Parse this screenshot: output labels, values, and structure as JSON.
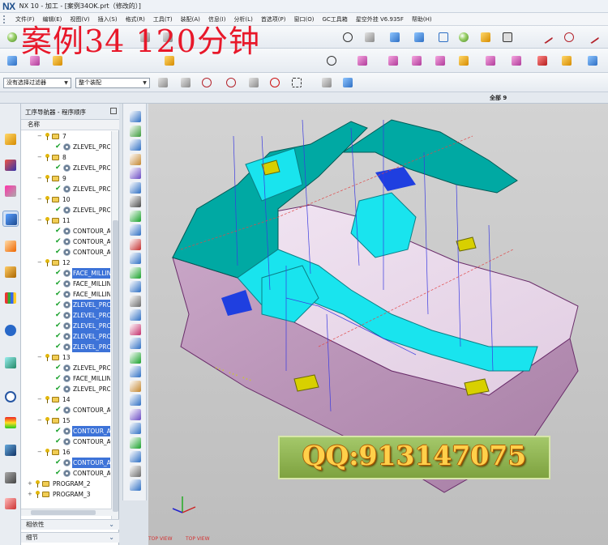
{
  "window": {
    "logo": "NX",
    "title": "NX 10 - 加工 - [案例34OK.prt（修改的）]"
  },
  "menu": [
    "文件(F)",
    "编辑(E)",
    "视图(V)",
    "插入(S)",
    "格式(R)",
    "工具(T)",
    "装配(A)",
    "信息(I)",
    "分析(L)",
    "首选项(P)",
    "窗口(O)",
    "GC工具箱",
    "星空外挂 V6.935F",
    "帮助(H)"
  ],
  "watermark": {
    "title": "案例34  120分钟",
    "qq": "QQ:913147075"
  },
  "toolbar": {
    "filter_select": "没有选择过滤器",
    "assembly_select": "整个装配"
  },
  "status": {
    "all_count": "全部 9"
  },
  "navigator": {
    "title": "工序导航器 - 程序顺序",
    "column_name": "名称",
    "rows": [
      {
        "type": "group",
        "label": "7"
      },
      {
        "type": "op",
        "label": "ZLEVEL_PROFILE",
        "selected": false
      },
      {
        "type": "group",
        "label": "8"
      },
      {
        "type": "op",
        "label": "ZLEVEL_PROFILE",
        "selected": false
      },
      {
        "type": "group",
        "label": "9"
      },
      {
        "type": "op",
        "label": "ZLEVEL_PROFILE",
        "selected": false
      },
      {
        "type": "group",
        "label": "10"
      },
      {
        "type": "op",
        "label": "ZLEVEL_PROFILE",
        "selected": false
      },
      {
        "type": "group",
        "label": "11"
      },
      {
        "type": "op",
        "label": "CONTOUR_AREA",
        "selected": false
      },
      {
        "type": "op",
        "label": "CONTOUR_AREA",
        "selected": false
      },
      {
        "type": "op",
        "label": "CONTOUR_AREA",
        "selected": false
      },
      {
        "type": "group",
        "label": "12"
      },
      {
        "type": "op",
        "label": "FACE_MILLING",
        "selected": true
      },
      {
        "type": "op",
        "label": "FACE_MILLING",
        "selected": false
      },
      {
        "type": "op",
        "label": "FACE_MILLING",
        "selected": false
      },
      {
        "type": "op",
        "label": "ZLEVEL_PROFILE",
        "selected": true
      },
      {
        "type": "op",
        "label": "ZLEVEL_PROFILE",
        "selected": true
      },
      {
        "type": "op",
        "label": "ZLEVEL_PROFILE",
        "selected": true
      },
      {
        "type": "op",
        "label": "ZLEVEL_PROFILE",
        "selected": true
      },
      {
        "type": "op",
        "label": "ZLEVEL_PROFILE",
        "selected": true
      },
      {
        "type": "group",
        "label": "13"
      },
      {
        "type": "op",
        "label": "ZLEVEL_PROFILE",
        "selected": false
      },
      {
        "type": "op",
        "label": "FACE_MILLING",
        "selected": false
      },
      {
        "type": "op",
        "label": "ZLEVEL_PROFILE",
        "selected": false
      },
      {
        "type": "group",
        "label": "14"
      },
      {
        "type": "op",
        "label": "CONTOUR_AREA",
        "selected": false
      },
      {
        "type": "group",
        "label": "15"
      },
      {
        "type": "op",
        "label": "CONTOUR_AREA",
        "selected": true
      },
      {
        "type": "op",
        "label": "CONTOUR_AREA",
        "selected": false
      },
      {
        "type": "group",
        "label": "16"
      },
      {
        "type": "op",
        "label": "CONTOUR_AREA",
        "selected": true
      },
      {
        "type": "op",
        "label": "CONTOUR_AREA",
        "selected": false
      },
      {
        "type": "program",
        "label": "PROGRAM_2"
      },
      {
        "type": "program",
        "label": "PROGRAM_3"
      }
    ],
    "footer": [
      "相依性",
      "细节"
    ]
  },
  "viewport": {
    "labels": [
      "TOP VIEW",
      "TOP VIEW"
    ]
  },
  "icons": {
    "toolbar_row1": [
      "open-icon",
      "undo-icon",
      "redo-icon",
      "zoom-icon",
      "fit-icon",
      "shaded-cube-icon",
      "wire-cube-icon",
      "sphere-icon",
      "line-icon",
      "circle-icon"
    ],
    "resource_bar": [
      "gear-icon",
      "assembly-icon",
      "constraint-icon",
      "part-icon",
      "operation-navigator-icon",
      "machine-icon",
      "roles-icon",
      "palette-icon",
      "wifi-icon",
      "history-icon",
      "clock-icon",
      "color-icon",
      "tool-icon",
      "lathe-icon",
      "notes-icon"
    ]
  },
  "colors": {
    "accent": "#3d73d8",
    "part_top": "#00b7b4",
    "part_side": "#c9a7c7",
    "cyan_face": "#19e4ee",
    "yellow_face": "#d8d000",
    "blue_face": "#1f3fe0",
    "watermark": "#e8182a"
  }
}
